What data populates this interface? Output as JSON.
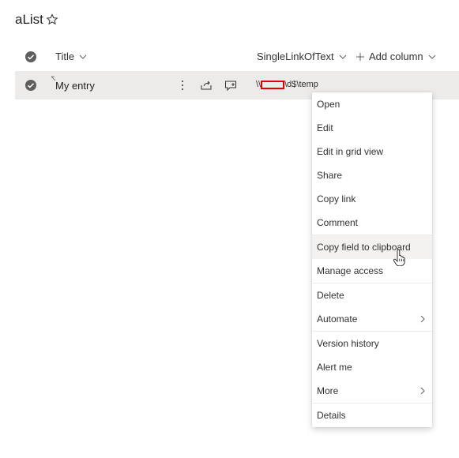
{
  "list": {
    "title": "aList"
  },
  "columns": {
    "title": "Title",
    "link": "SingleLinkOfText",
    "add": "Add column"
  },
  "row": {
    "title": "My entry",
    "link_prefix": "\\\\",
    "link_suffix": "\\d$\\temp"
  },
  "menu": {
    "items": [
      "Open",
      "Edit",
      "Edit in grid view",
      "Share",
      "Copy link",
      "Comment",
      "Copy field to clipboard",
      "Manage access",
      "Delete",
      "Automate",
      "Version history",
      "Alert me",
      "More",
      "Details"
    ],
    "hovered": "Copy field to clipboard"
  }
}
